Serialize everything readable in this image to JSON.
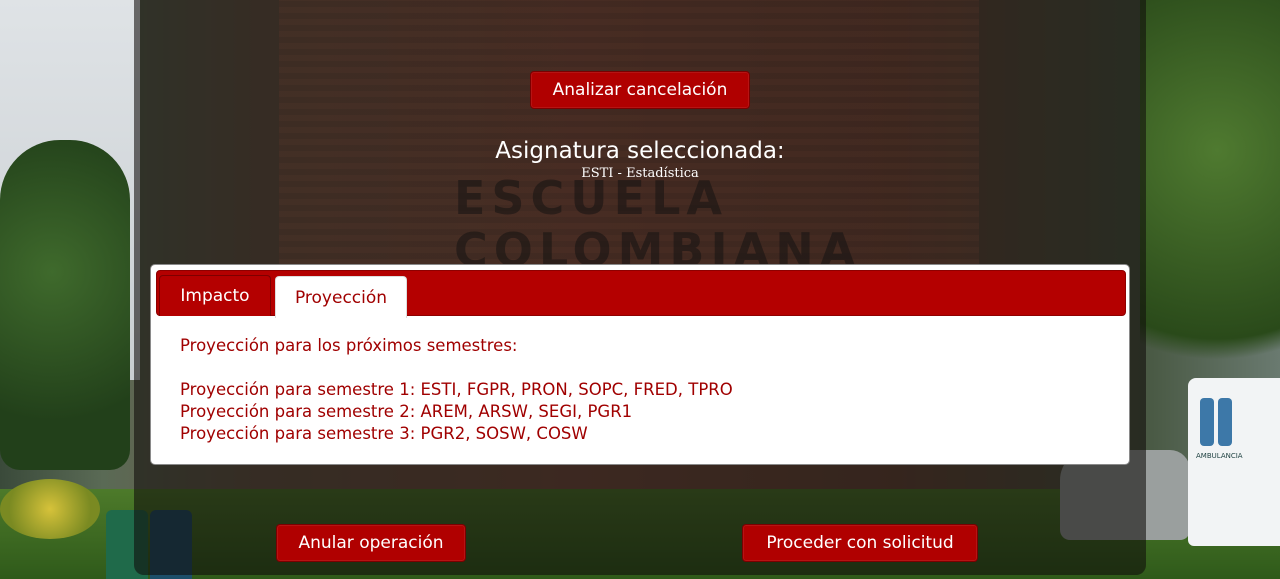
{
  "actions": {
    "analyze_label": "Analizar cancelación",
    "cancel_label": "Anular operación",
    "proceed_label": "Proceder con solicitud"
  },
  "selection": {
    "title": "Asignatura seleccionada:",
    "value": "ESTI - Estadística"
  },
  "tabs": [
    {
      "label": "Impacto",
      "active": false
    },
    {
      "label": "Proyección",
      "active": true
    }
  ],
  "projection": {
    "heading": "Proyección para los próximos semestres:",
    "semesters": [
      "Proyección para semestre 1: ESTI, FGPR, PRON, SOPC, FRED, TPRO",
      "Proyección para semestre 2: AREM, ARSW, SEGI, PGR1",
      "Proyección para semestre 3: PGR2, SOSW, COSW"
    ]
  },
  "background": {
    "wall_text_line1": "ESCUELA",
    "wall_text_line2": "COLOMBIANA",
    "ambulance_text": "AMBULANCIA"
  },
  "colors": {
    "accent": "#b00000",
    "tab_text_active": "#a00000",
    "overlay": "rgba(16,12,10,0.58)"
  }
}
